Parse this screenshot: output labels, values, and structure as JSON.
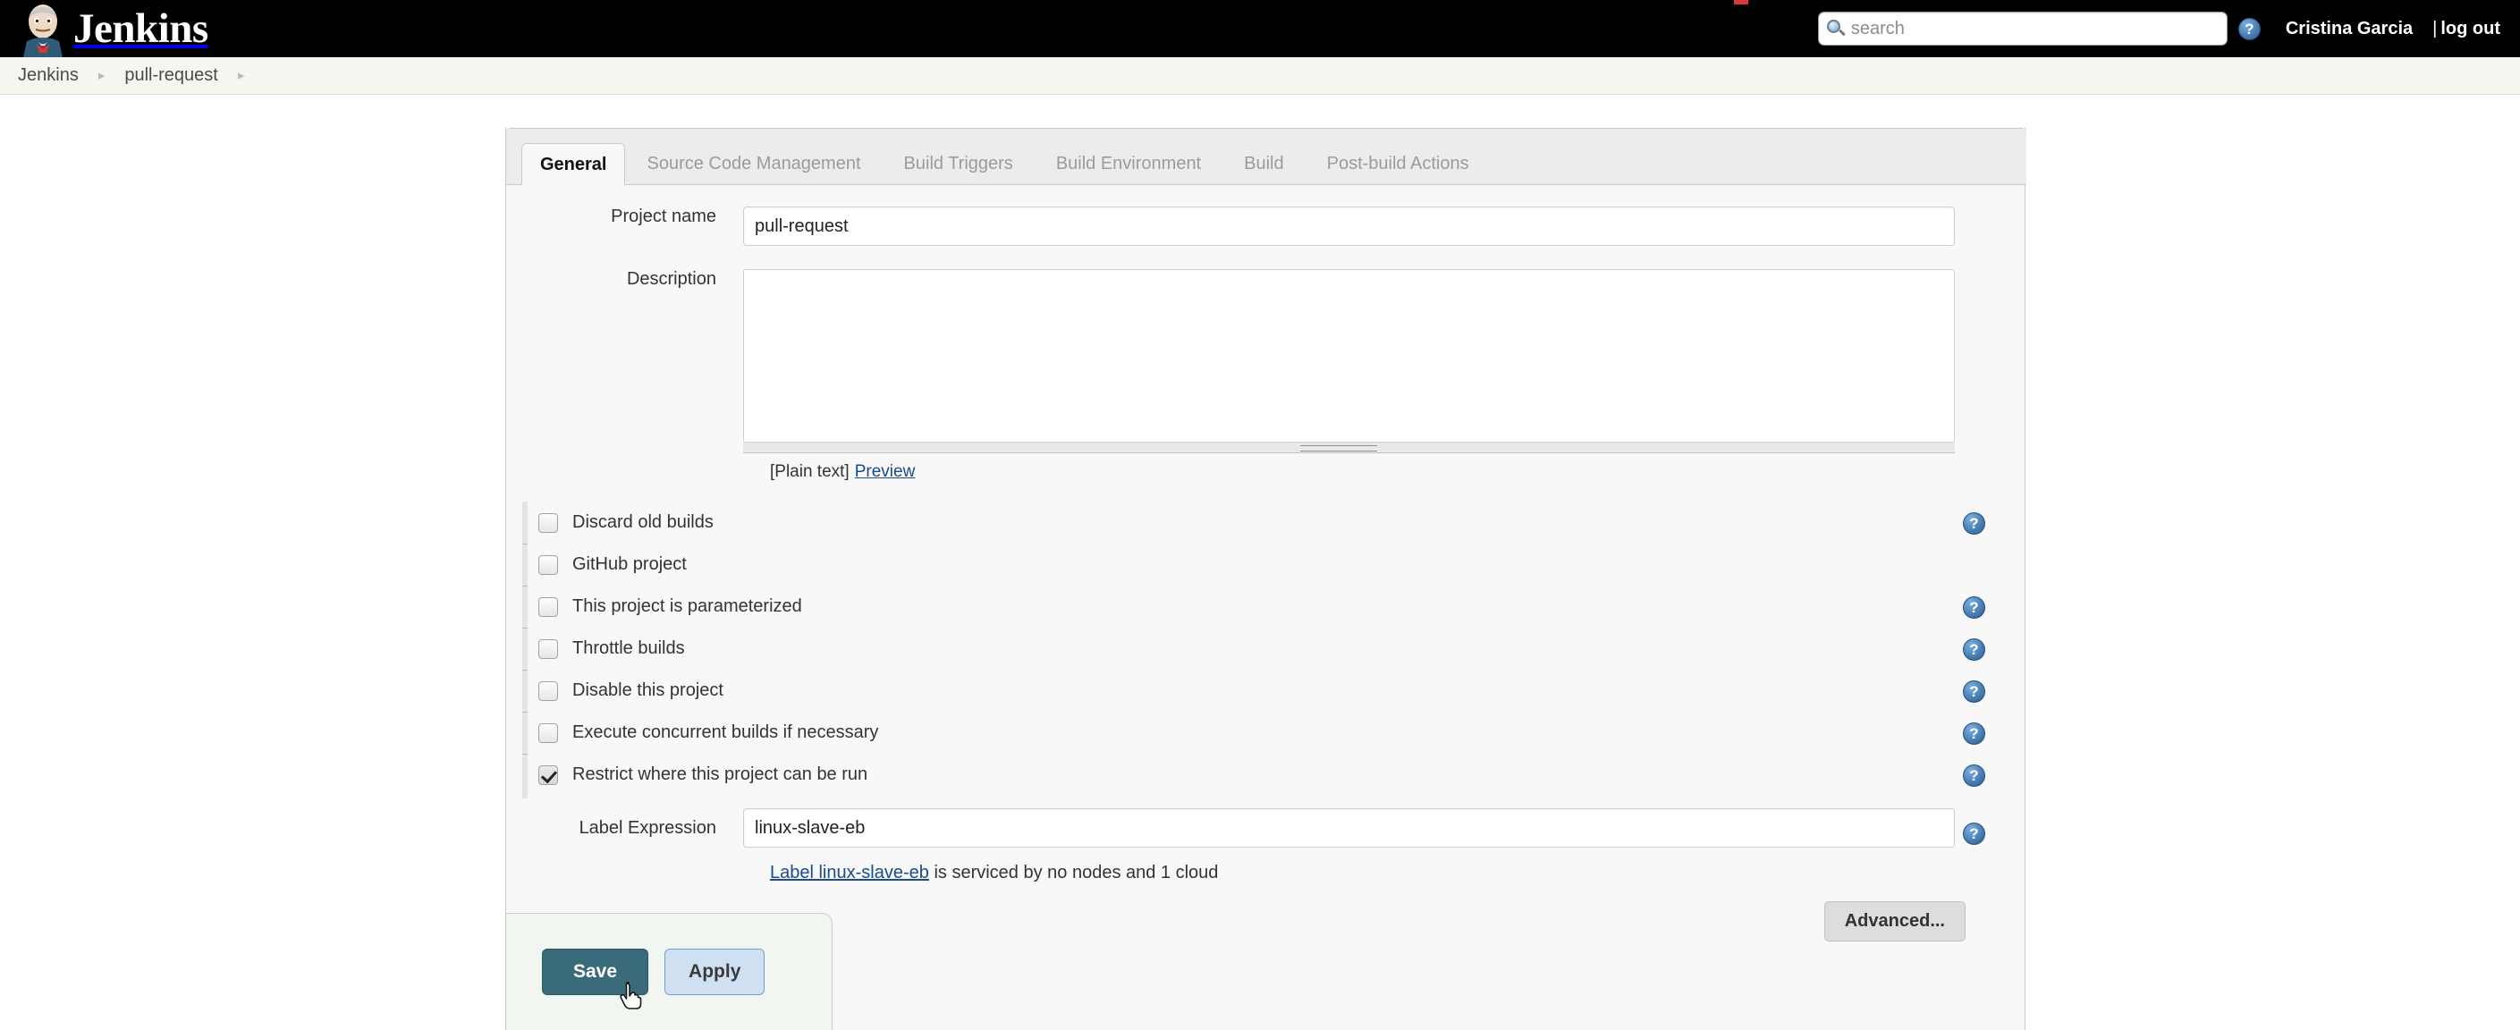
{
  "header": {
    "brand_text": "Jenkins",
    "brand_icon": "jenkins-butler-logo",
    "search": {
      "placeholder": "search",
      "value": "",
      "icon": "search-icon"
    },
    "help_icon": "help-question-icon",
    "user_name": "Cristina Garcia",
    "logout_separator": "|",
    "logout_label": "log out"
  },
  "breadcrumb": {
    "items": [
      {
        "label": "Jenkins"
      },
      {
        "label": "pull-request"
      }
    ],
    "separator_icon": "chevron-right-icon"
  },
  "tabs": [
    {
      "label": "General",
      "active": true
    },
    {
      "label": "Source Code Management",
      "active": false
    },
    {
      "label": "Build Triggers",
      "active": false
    },
    {
      "label": "Build Environment",
      "active": false
    },
    {
      "label": "Build",
      "active": false
    },
    {
      "label": "Post-build Actions",
      "active": false
    }
  ],
  "form": {
    "project_name": {
      "label": "Project name",
      "value": "pull-request",
      "placeholder": ""
    },
    "description": {
      "label": "Description",
      "value": "",
      "placeholder": "",
      "markup_note": "[Plain text]",
      "preview_link": "Preview"
    },
    "checkboxes": [
      {
        "label": "Discard old builds",
        "checked": false,
        "has_help": true
      },
      {
        "label": "GitHub project",
        "checked": false,
        "has_help": false
      },
      {
        "label": "This project is parameterized",
        "checked": false,
        "has_help": true
      },
      {
        "label": "Throttle builds",
        "checked": false,
        "has_help": true
      },
      {
        "label": "Disable this project",
        "checked": false,
        "has_help": true
      },
      {
        "label": "Execute concurrent builds if necessary",
        "checked": false,
        "has_help": true
      },
      {
        "label": "Restrict where this project can be run",
        "checked": true,
        "has_help": true
      }
    ],
    "label_expression": {
      "label": "Label Expression",
      "value": "linux-slave-eb",
      "placeholder": "",
      "has_help": true,
      "serviced_link": "Label linux-slave-eb",
      "serviced_text": " is serviced by no nodes and 1 cloud"
    },
    "advanced_button": "Advanced..."
  },
  "footer": {
    "save_label": "Save",
    "apply_label": "Apply",
    "cursor_icon": "pointing-hand-cursor"
  },
  "colors": {
    "header_bg": "#000000",
    "breadcrumb_bg": "#f4f7ef",
    "panel_bg": "#f8f8f8",
    "tab_bar_bg": "#ececec",
    "save_btn_bg": "#3a6b7b",
    "apply_btn_bg": "#cfe0f3",
    "link_blue": "#1a4b8c",
    "help_icon_blue": "#4a7fb5",
    "savebar_bg": "#f1f7f0"
  }
}
